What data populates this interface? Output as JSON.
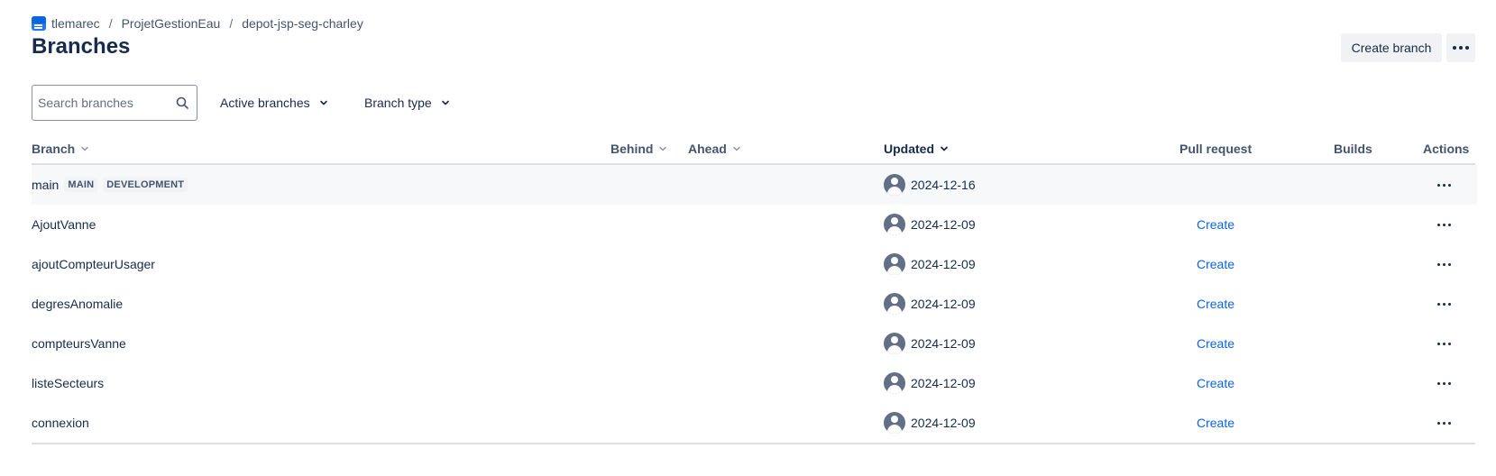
{
  "breadcrumb": {
    "workspace": "tlemarec",
    "project": "ProjetGestionEau",
    "repository": "depot-jsp-seg-charley",
    "separator": "/"
  },
  "page": {
    "title": "Branches"
  },
  "toolbar": {
    "create_branch_label": "Create branch",
    "more_icon": "more-horizontal-icon"
  },
  "filters": {
    "search_placeholder": "Search branches",
    "search_value": "",
    "active_branches_label": "Active branches",
    "branch_type_label": "Branch type"
  },
  "table": {
    "columns": {
      "branch": "Branch",
      "behind": "Behind",
      "ahead": "Ahead",
      "updated": "Updated",
      "pull_request": "Pull request",
      "builds": "Builds",
      "actions": "Actions"
    },
    "sort": {
      "column": "updated",
      "direction": "descending"
    },
    "rows": [
      {
        "name": "main",
        "lozenges": [
          "MAIN",
          "DEVELOPMENT"
        ],
        "updated": "2024-12-16",
        "pull_request": ""
      },
      {
        "name": "AjoutVanne",
        "lozenges": [],
        "updated": "2024-12-09",
        "pull_request": "Create"
      },
      {
        "name": "ajoutCompteurUsager",
        "lozenges": [],
        "updated": "2024-12-09",
        "pull_request": "Create"
      },
      {
        "name": "degresAnomalie",
        "lozenges": [],
        "updated": "2024-12-09",
        "pull_request": "Create"
      },
      {
        "name": "compteursVanne",
        "lozenges": [],
        "updated": "2024-12-09",
        "pull_request": "Create"
      },
      {
        "name": "listeSecteurs",
        "lozenges": [],
        "updated": "2024-12-09",
        "pull_request": "Create"
      },
      {
        "name": "connexion",
        "lozenges": [],
        "updated": "2024-12-09",
        "pull_request": "Create"
      }
    ]
  },
  "colors": {
    "text_primary": "#172b4d",
    "text_subtle": "#44546f",
    "link": "#0c66e4",
    "button_bg": "#f1f2f4",
    "row_highlight": "#f7f8f9",
    "border": "#dcdfe4"
  }
}
